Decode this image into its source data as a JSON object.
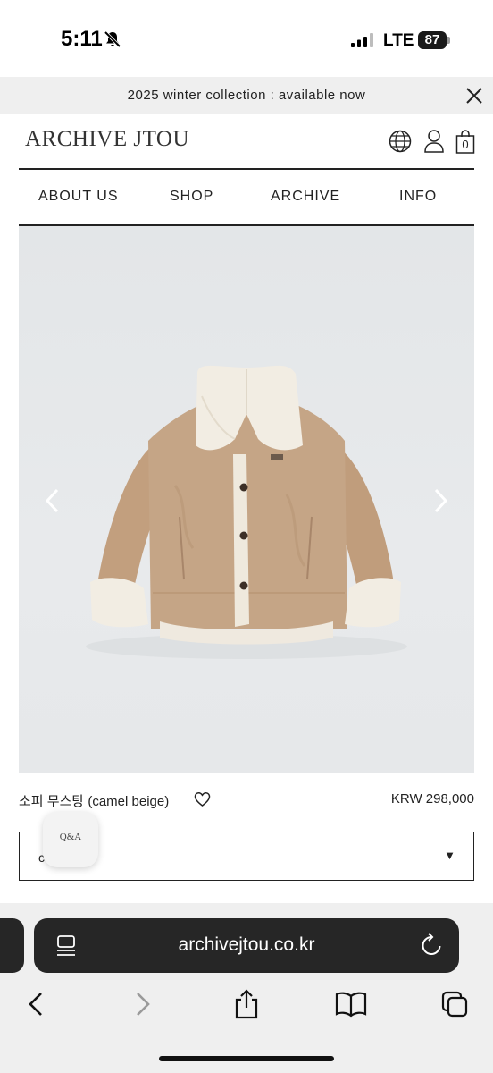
{
  "status_bar": {
    "time": "5:11",
    "network": "LTE",
    "battery": "87"
  },
  "announcement": {
    "text": "2025 winter collection : available now",
    "close_icon": "close-icon"
  },
  "header": {
    "logo": "ARCHIVE JTOU",
    "cart_count": "0",
    "icons": [
      "globe-icon",
      "user-icon",
      "cart-icon"
    ]
  },
  "nav": {
    "items": [
      "ABOUT US",
      "SHOP",
      "ARCHIVE",
      "INFO"
    ]
  },
  "product": {
    "name": "소피 무스탕 (camel beige)",
    "price": "KRW 298,000",
    "option_value": "co",
    "option_caret": "▼",
    "qa_label": "Q&A"
  },
  "browser": {
    "url": "archivejtou.co.kr",
    "toolbar_icons": [
      "back-icon",
      "forward-icon",
      "share-icon",
      "bookmarks-icon",
      "tabs-icon"
    ]
  },
  "colors": {
    "url_bar": "#262626",
    "announce_bg": "#efefef",
    "coat": "#c4a485",
    "shearling": "#f0ebe1"
  }
}
